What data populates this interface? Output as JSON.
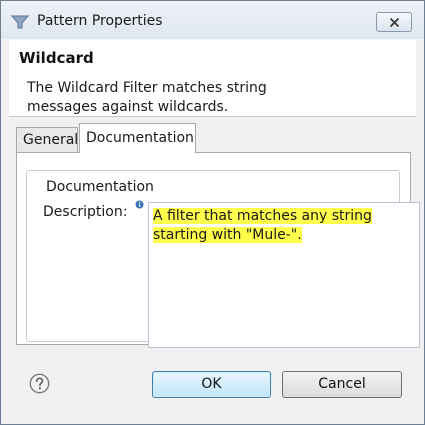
{
  "window": {
    "title": "Pattern Properties",
    "close_icon": "close-icon",
    "app_icon": "pattern-icon"
  },
  "banner": {
    "title": "Wildcard",
    "description": "The Wildcard Filter matches string messages against wildcards."
  },
  "tabs": [
    {
      "label": "General",
      "selected": false
    },
    {
      "label": "Documentation",
      "selected": true
    }
  ],
  "documentation": {
    "group_label": "Documentation",
    "description_label": "Description:",
    "info_icon": "info-icon",
    "description_value": "A filter that matches any string starting with \"Mule-\".",
    "highlight_color": "#ffff4c"
  },
  "footer": {
    "help_icon": "help-icon",
    "ok_label": "OK",
    "cancel_label": "Cancel"
  }
}
